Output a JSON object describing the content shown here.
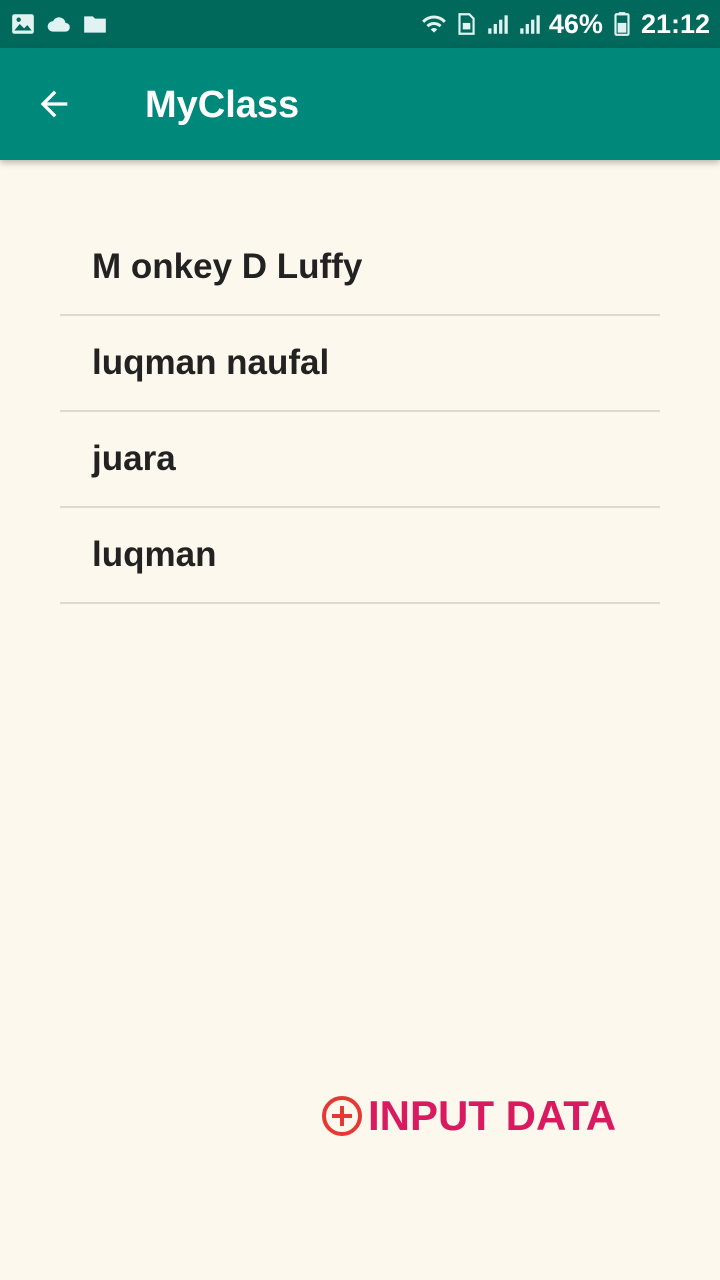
{
  "status_bar": {
    "battery": "46%",
    "time": "21:12",
    "icons": [
      "image-icon",
      "cloud-icon",
      "folder-icon",
      "wifi-icon",
      "sim-icon",
      "signal-icon",
      "signal-icon",
      "battery-icon"
    ]
  },
  "app_bar": {
    "title": "MyClass",
    "back_icon": "arrow-back-icon"
  },
  "list": {
    "items": [
      {
        "label": "M onkey D Luffy"
      },
      {
        "label": "luqman naufal"
      },
      {
        "label": "juara"
      },
      {
        "label": "luqman"
      }
    ]
  },
  "action": {
    "label": "INPUT DATA",
    "icon": "plus-circle-icon"
  },
  "colors": {
    "status_bar": "#00695c",
    "app_bar": "#00897b",
    "background": "#fdf8ee",
    "accent": "#d81b60",
    "plus_icon": "#e53935"
  }
}
